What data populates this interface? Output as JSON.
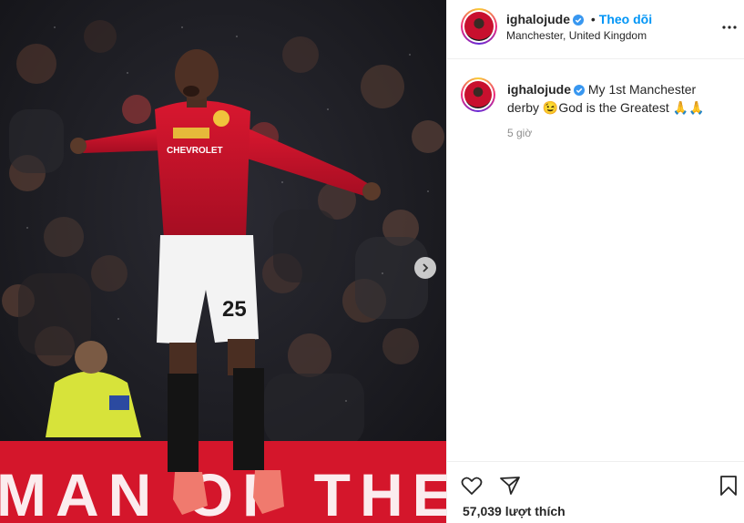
{
  "post": {
    "username": "ighalojude",
    "follow_label": "Theo dõi",
    "separator": "•",
    "location": "Manchester, United Kingdom",
    "caption_text": "My 1st Manchester derby 😉God is the Greatest 🙏🙏",
    "time_ago": "5 giờ",
    "likes_count": "57,039",
    "likes_label": "lượt thích"
  },
  "photo": {
    "banner_text": "MAN OF THE",
    "sponsor_text": "CHEVROLET",
    "shirt_number": "25"
  },
  "colors": {
    "accent_blue": "#0095f6",
    "verified_blue": "#3897f0",
    "kit_red": "#c8102e"
  },
  "icons": [
    "verified-badge-icon",
    "more-options-icon",
    "carousel-next-icon",
    "heart-icon",
    "share-icon",
    "bookmark-icon"
  ]
}
